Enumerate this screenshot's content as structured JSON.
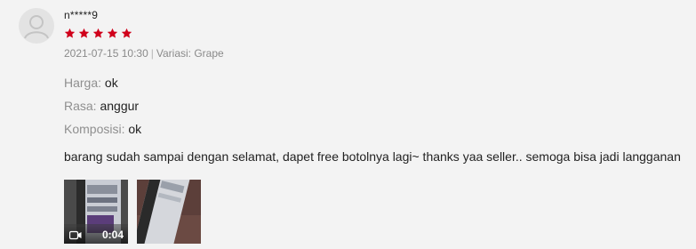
{
  "review": {
    "username": "n*****9",
    "rating": 5,
    "date": "2021-07-15 10:30",
    "separator": "|",
    "variation": "Variasi: Grape",
    "attributes": [
      {
        "key": "Harga:",
        "value": "ok"
      },
      {
        "key": "Rasa:",
        "value": "anggur"
      },
      {
        "key": "Komposisi:",
        "value": "ok"
      }
    ],
    "comment": "barang sudah sampai dengan selamat, dapet free botolnya lagi~ thanks yaa seller.. semoga bisa jadi langganan",
    "media": [
      {
        "type": "video",
        "duration": "0:04",
        "icon": "video-camera-icon"
      },
      {
        "type": "image"
      }
    ]
  },
  "colors": {
    "star": "#d0011b",
    "background": "#f3f3f3",
    "muted": "#8f8f8f"
  }
}
